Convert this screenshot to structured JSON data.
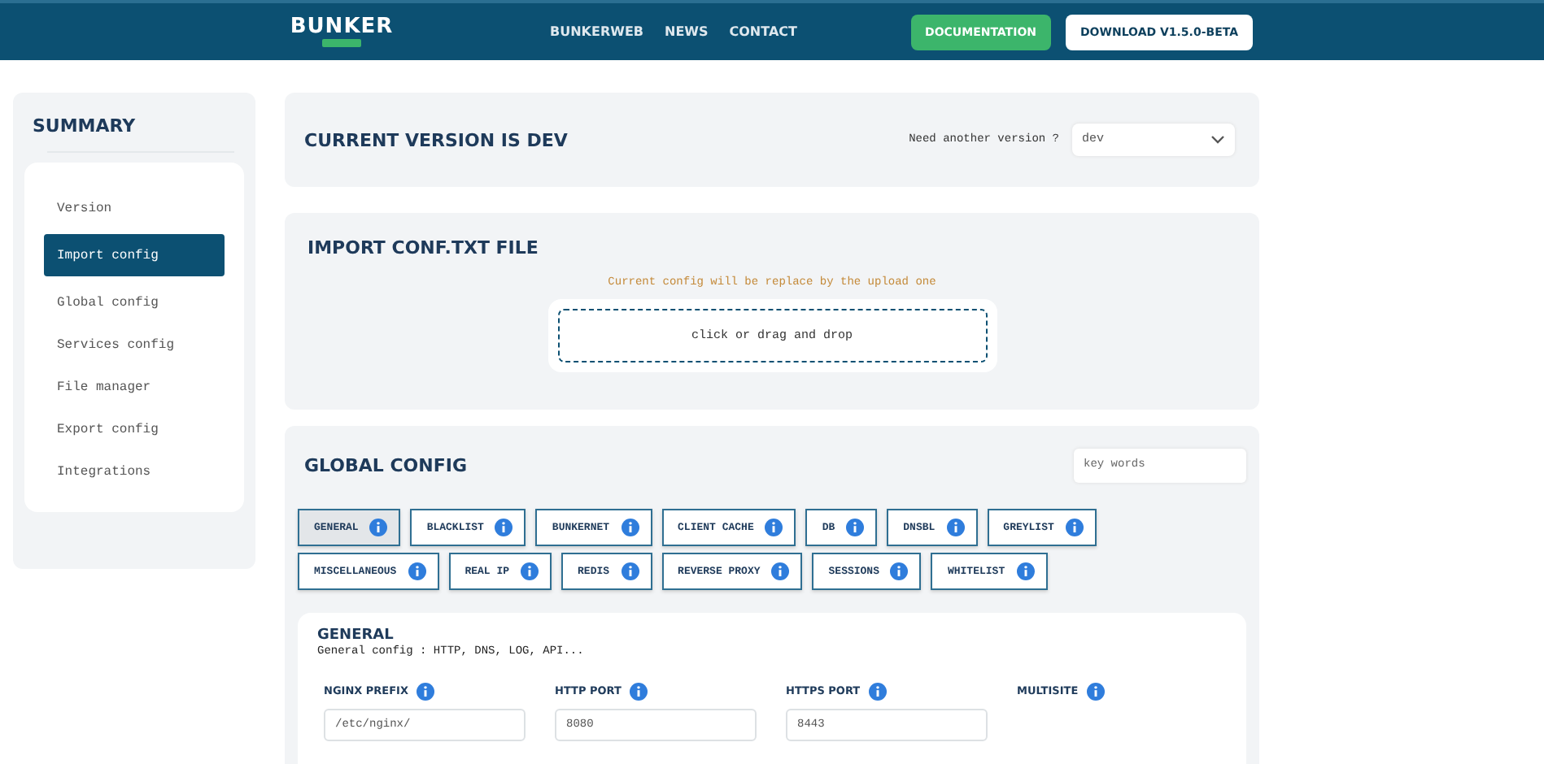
{
  "header": {
    "logo": "BUNKER",
    "nav": [
      "BUNKERWEB",
      "NEWS",
      "CONTACT"
    ],
    "buttons": [
      {
        "label": "DOCUMENTATION",
        "kind": "primary"
      },
      {
        "label": "DOWNLOAD V1.5.0-BETA",
        "kind": "secondary"
      }
    ]
  },
  "summary": {
    "title": "SUMMARY",
    "items": [
      {
        "label": "Version",
        "selected": false
      },
      {
        "label": "Import config",
        "selected": true
      },
      {
        "label": "Global config",
        "selected": false
      },
      {
        "label": "Services config",
        "selected": false
      },
      {
        "label": "File manager",
        "selected": false
      },
      {
        "label": "Export config",
        "selected": false
      },
      {
        "label": "Integrations",
        "selected": false
      }
    ]
  },
  "version": {
    "title": "CURRENT VERSION IS DEV",
    "prompt": "Need another version ?",
    "select": "dev"
  },
  "import": {
    "title": "IMPORT CONF.TXT FILE",
    "notice": "Current config will be replace by the upload one",
    "dropzone": "click or drag and drop"
  },
  "global": {
    "title": "GLOBAL CONFIG",
    "search": {
      "placeholder": "key words"
    },
    "tabs": [
      {
        "label": "GENERAL",
        "selected": true
      },
      {
        "label": "BLACKLIST",
        "selected": false
      },
      {
        "label": "BUNKERNET",
        "selected": false
      },
      {
        "label": "CLIENT CACHE",
        "selected": false
      },
      {
        "label": "DB",
        "selected": false
      },
      {
        "label": "DNSBL",
        "selected": false
      },
      {
        "label": "GREYLIST",
        "selected": false
      },
      {
        "label": "MISCELLANEOUS",
        "selected": false
      },
      {
        "label": "REAL IP",
        "selected": false
      },
      {
        "label": "REDIS",
        "selected": false
      },
      {
        "label": "REVERSE PROXY",
        "selected": false
      },
      {
        "label": "SESSIONS",
        "selected": false
      },
      {
        "label": "WHITELIST",
        "selected": false
      }
    ],
    "section": {
      "title": "GENERAL",
      "description": "General config : HTTP, DNS, LOG, API...",
      "fields": [
        {
          "label": "NGINX PREFIX",
          "value": "/etc/nginx/"
        },
        {
          "label": "HTTP PORT",
          "value": "8080"
        },
        {
          "label": "HTTPS PORT",
          "value": "8443"
        },
        {
          "label": "MULTISITE"
        }
      ]
    }
  }
}
